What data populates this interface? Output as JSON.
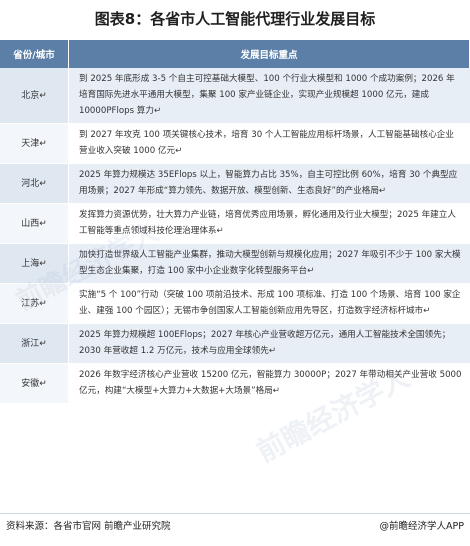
{
  "title": "图表8：各省市人工智能代理行业发展目标",
  "table": {
    "headers": [
      "省份/城市",
      "发展目标重点"
    ],
    "rows": [
      {
        "city": "北京↵",
        "text": "到 2025 年底形成 3-5 个自主可控基础大模型、100 个行业大模型和 1000 个成功案例；2026 年培育国际先进水平通用大模型，集聚 100 家产业链企业，实现产业规模超 1000 亿元，建成 10000PFlops 算力↵"
      },
      {
        "city": "天津↵",
        "text": "到 2027 年攻克 100 项关键核心技术，培育 30 个人工智能应用标杆场景，人工智能基础核心企业营业收入突破 1000 亿元↵"
      },
      {
        "city": "河北↵",
        "text": "2025 年算力规模达 35EFlops 以上，智能算力占比 35%，自主可控比例 60%，培育 30 个典型应用场景；2027 年形成“算力领先、数据开放、模型创新、生态良好”的产业格局↵"
      },
      {
        "city": "山西↵",
        "text": "发挥算力资源优势，壮大算力产业链，培育优秀应用场景，孵化通用及行业大模型；2025 年建立人工智能等重点领域科技伦理治理体系↵"
      },
      {
        "city": "上海↵",
        "text": "加快打造世界级人工智能产业集群，推动大模型创新与规模化应用；2027 年吸引不少于 100 家大模型生态企业集聚，打造 100 家中小企业数字化转型服务平台↵"
      },
      {
        "city": "江苏↵",
        "text": "实施“5 个 100”行动（突破 100 项前沿技术、形成 100 项标准、打造 100 个场景、培育 100 家企业、建强 100 个园区）；无锡市争创国家人工智能创新应用先导区，打造数字经济标杆城市↵"
      },
      {
        "city": "浙江↵",
        "text": "2025 年算力规模超 100EFlops；2027 年核心产业营收超万亿元，通用人工智能技术全国领先；2030 年营收超 1.2 万亿元，技术与应用全球领先↵"
      },
      {
        "city": "安徽↵",
        "text": "2026 年数字经济核心产业营收 15200 亿元，智能算力 30000P；2027 年带动相关产业营收 5000 亿元，构建“大模型+大算力+大数据+大场景”格局↵"
      }
    ]
  },
  "footer": {
    "source": "资料来源：各省市官网 前瞻产业研究院",
    "brand": "@前瞻经济学人APP"
  },
  "watermark": "前瞻经济学人"
}
